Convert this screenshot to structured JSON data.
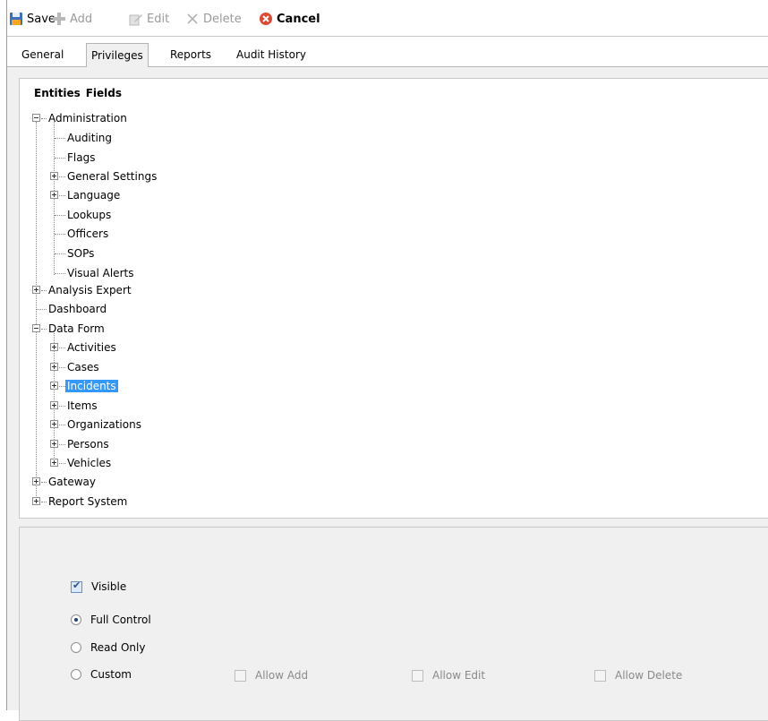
{
  "toolbar": {
    "save": "Save",
    "add": "Add",
    "edit": "Edit",
    "delete": "Delete",
    "cancel": "Cancel"
  },
  "tabs": [
    "General",
    "Privileges",
    "Reports",
    "Audit History"
  ],
  "active_tab": "Privileges",
  "tree": {
    "heading_1": "Entities",
    "heading_2": "Fields",
    "nodes": {
      "administration": "Administration",
      "auditing": "Auditing",
      "flags": "Flags",
      "general_settings": "General Settings",
      "language": "Language",
      "lookups": "Lookups",
      "officers": "Officers",
      "sops": "SOPs",
      "visual_alerts": "Visual Alerts",
      "analysis_expert": "Analysis Expert",
      "dashboard": "Dashboard",
      "data_form": "Data Form",
      "activities": "Activities",
      "cases": "Cases",
      "incidents": "Incidents",
      "items": "Items",
      "organizations": "Organizations",
      "persons": "Persons",
      "vehicles": "Vehicles",
      "gateway": "Gateway",
      "report_system": "Report System"
    },
    "selected": "Incidents"
  },
  "options": {
    "visible": "Visible",
    "full_control": "Full Control",
    "read_only": "Read Only",
    "custom": "Custom",
    "allow_add": "Allow Add",
    "allow_edit": "Allow Edit",
    "allow_delete": "Allow Delete"
  },
  "colors": {
    "selection": "#3399ff",
    "panel_background": "#f0f0f0"
  }
}
